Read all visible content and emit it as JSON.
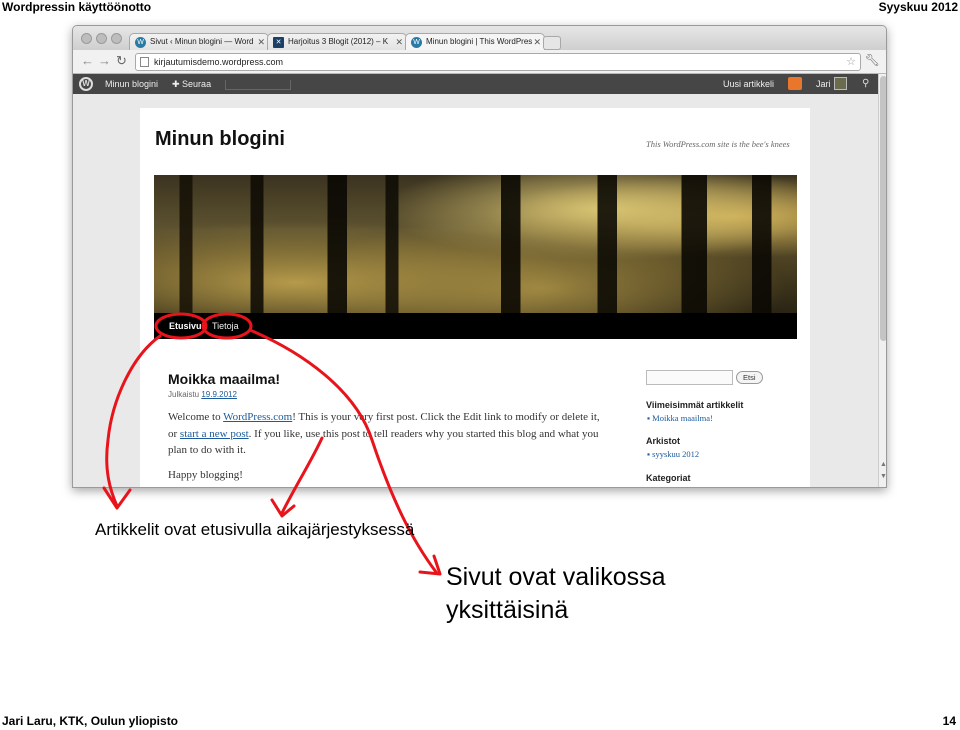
{
  "slide": {
    "title": "Wordpressin käyttöönotto",
    "date": "Syyskuu 2012",
    "footer": "Jari Laru, KTK, Oulun yliopisto",
    "page_number": "14"
  },
  "browser": {
    "tabs": [
      {
        "label": "Sivut ‹ Minun blogini — Word",
        "icon": "wordpress-icon",
        "active": false
      },
      {
        "label": "Harjoitus 3 Blogit (2012) – K",
        "icon": "cross-icon",
        "active": false
      },
      {
        "label": "Minun blogini | This WordPres",
        "icon": "wordpress-icon",
        "active": true
      }
    ],
    "url": "kirjautumisdemo.wordpress.com"
  },
  "adminbar": {
    "my_blog": "Minun blogini",
    "follow": "Seuraa",
    "new_post": "Uusi artikkeli",
    "user": "Jari"
  },
  "blog": {
    "title": "Minun blogini",
    "tagline": "This WordPress.com site is the bee's knees",
    "menu": [
      "Etusivu",
      "Tietoja"
    ],
    "post": {
      "title": "Moikka maailma!",
      "published_label": "Julkaistu",
      "published_date": "19.9.2012",
      "p1_a": "Welcome to ",
      "p1_link1": "WordPress.com",
      "p1_b": "! This is your very first post. Click the Edit link to modify or delete it, or ",
      "p1_link2": "start a new post",
      "p1_c": ". If you like, use this post to tell readers why you started this blog and what you plan to do with it.",
      "p2": "Happy blogging!"
    },
    "sidebar": {
      "search_button": "Etsi",
      "recent_title": "Viimeisimmät artikkelit",
      "recent_link": "Moikka maailma!",
      "archives_title": "Arkistot",
      "archive_link": "syyskuu 2012",
      "categories_title": "Kategoriat"
    }
  },
  "annotations": {
    "caption_posts": "Artikkelit ovat etusivulla aikajärjestyksessä",
    "caption_pages_line1": "Sivut ovat valikossa",
    "caption_pages_line2": "yksittäisinä",
    "ink_color": "#e8141b"
  }
}
